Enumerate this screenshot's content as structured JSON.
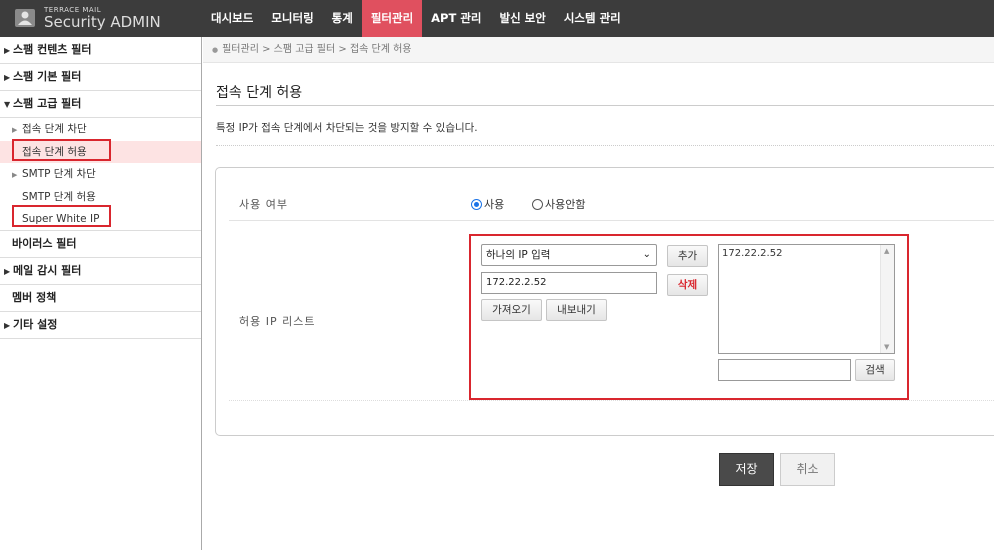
{
  "logo": {
    "small": "TERRACE MAIL",
    "big": "Security ADMIN",
    "icon": "admin-person-icon"
  },
  "nav": {
    "items": [
      "대시보드",
      "모니터링",
      "통계",
      "필터관리",
      "APT 관리",
      "발신 보안",
      "시스템 관리"
    ],
    "active": "필터관리",
    "active_color": "#e0505f"
  },
  "sidebar": {
    "spam_content": "스팸 컨텐츠 필터",
    "spam_basic": "스팸 기본 필터",
    "spam_advanced": "스팸 고급 필터",
    "sub": [
      "접속 단계 차단",
      "접속 단계 허용",
      "SMTP 단계 차단",
      "SMTP 단계 허용",
      "Super White IP"
    ],
    "virus": "바이러스 필터",
    "mail_monitor": "메일 감시 필터",
    "member_policy": "멤버 정책",
    "etc": "기타 설정"
  },
  "breadcrumb": "필터관리 > 스팸 고급 필터 > 접속 단계 허용",
  "page": {
    "title": "접속 단계 허용",
    "description": "특정 IP가 접속 단계에서 차단되는 것을 방지할 수 있습니다."
  },
  "form": {
    "use_label": "사용 여부",
    "use_on": "사용",
    "use_off": "사용안함",
    "use_selected": "사용",
    "ip_list_label": "허용 IP 리스트",
    "ip_mode": "하나의 IP 입력",
    "ip_input_value": "172.22.2.52",
    "add_button": "추가",
    "delete_button": "삭제",
    "import_button": "가져오기",
    "export_button": "내보내기",
    "list_items": [
      "172.22.2.52"
    ],
    "search_value": "",
    "search_button": "검색"
  },
  "actions": {
    "save": "저장",
    "cancel": "취소"
  }
}
